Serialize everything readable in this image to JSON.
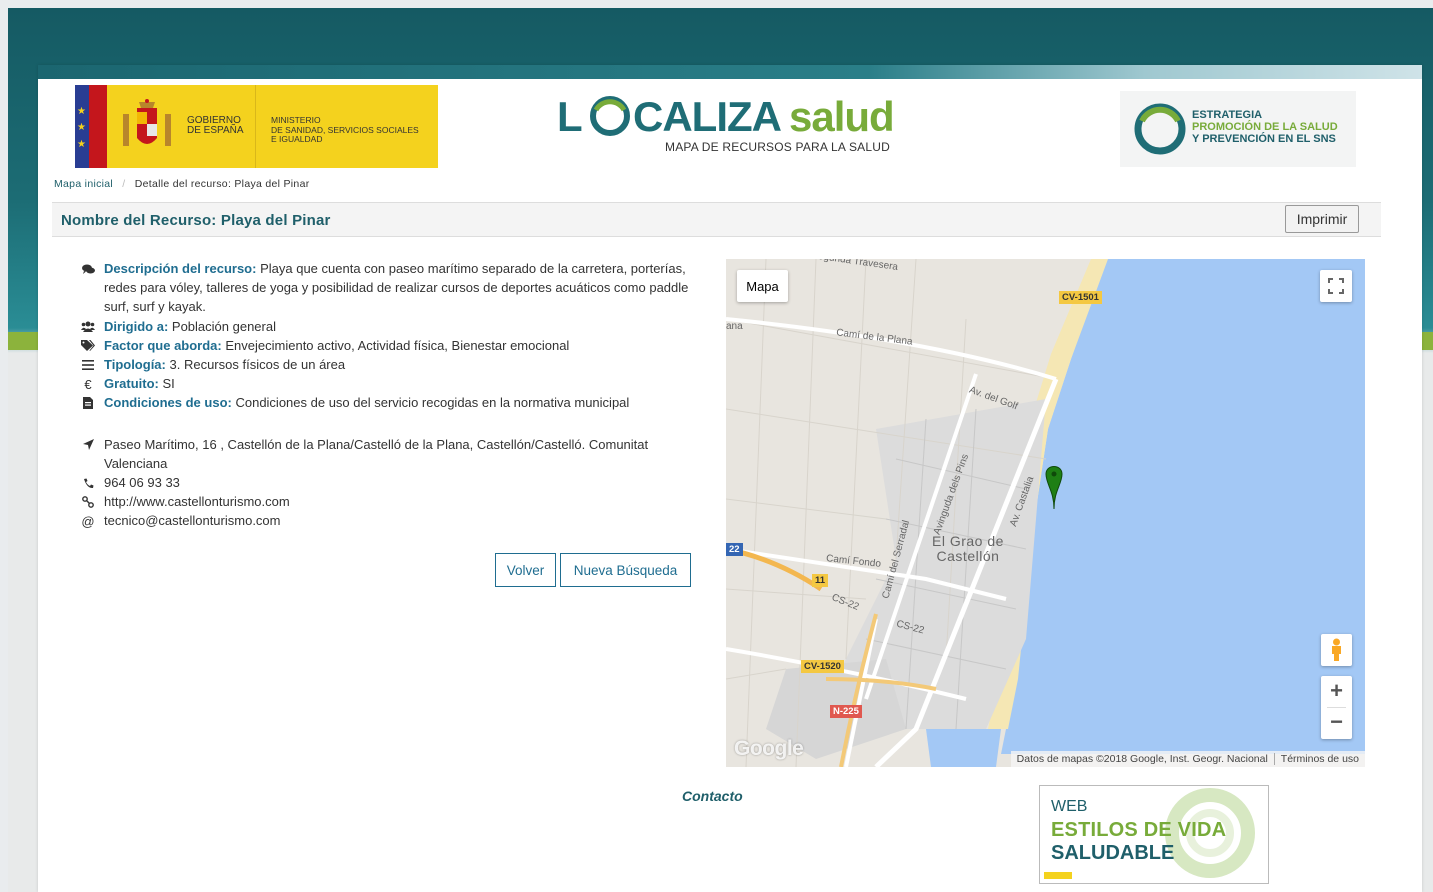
{
  "header": {
    "gov_line1": "GOBIERNO",
    "gov_line2": "DE ESPAÑA",
    "ministry_line1": "MINISTERIO",
    "ministry_line2": "DE SANIDAD, SERVICIOS SOCIALES",
    "ministry_line3": "E IGUALDAD",
    "brand_l": "L",
    "brand_caliza": "CALIZA",
    "brand_salud": "salud",
    "brand_subtitle": "MAPA DE RECURSOS PARA LA SALUD",
    "estrategia_line1": "ESTRATEGIA",
    "estrategia_line2": "PROMOCIÓN DE LA SALUD",
    "estrategia_line3": "Y PREVENCIÓN EN EL SNS"
  },
  "breadcrumb": {
    "home": "Mapa inicial",
    "separator": "/",
    "current": "Detalle del recurso: Playa del Pinar"
  },
  "resource": {
    "title": "Nombre del Recurso: Playa del Pinar",
    "print_label": "Imprimir",
    "description_label": "Descripción del recurso:",
    "description": "Playa que cuenta con paseo marítimo separado de la carretera, porterías, redes para vóley, talleres de yoga y posibilidad de realizar cursos de deportes acuáticos como paddle surf, surf y kayak.",
    "target_label": "Dirigido a:",
    "target": "Población general",
    "factor_label": "Factor que aborda:",
    "factor": "Envejecimiento activo, Actividad física, Bienestar emocional",
    "type_label": "Tipología:",
    "type": "3. Recursos físicos de un área",
    "free_label": "Gratuito:",
    "free": "SI",
    "conditions_label": "Condiciones de uso:",
    "conditions": "Condiciones de uso del servicio recogidas en la normativa municipal",
    "address": "Paseo Marítimo, 16 , Castellón de la Plana/Castelló de la Plana, Castellón/Castelló. Comunitat Valenciana",
    "phone": "964 06 93 33",
    "website": "http://www.castellonturismo.com",
    "email": "tecnico@castellonturismo.com",
    "back_label": "Volver",
    "new_search_label": "Nueva Búsqueda"
  },
  "map": {
    "type_label": "Mapa",
    "road_cv1501": "CV-1501",
    "road_cv1520": "CV-1520",
    "road_n225": "N-225",
    "road_22": "22",
    "road_11": "11",
    "street_travesera": "Segunda Travesera",
    "street_plana": "Camí de la Plana",
    "street_golf": "Av. del Golf",
    "street_pins": "Avinguda dels Pins",
    "street_castalia": "Av. Castalia",
    "street_serradal": "Camí del Serradal",
    "street_fondo": "Camí Fondo",
    "street_cs22a": "CS-22",
    "street_cs22b": "CS-22",
    "street_ana": "ana",
    "town_line1": "El Grao de",
    "town_line2": "Castellón",
    "logo": "Google",
    "attribution": "Datos de mapas ©2018 Google, Inst. Geogr. Nacional",
    "terms": "Términos de uso",
    "zoom_in": "+",
    "zoom_out": "−",
    "colors": {
      "sea": "#a3c8f5",
      "beach": "#f5e7b4",
      "land": "#e6e3dc",
      "marker": "#1e7f14"
    }
  },
  "footer": {
    "contact": "Contacto",
    "banner_web": "WEB",
    "banner_line1": "ESTILOS DE VIDA",
    "banner_line2": "SALUDABLE"
  },
  "icons": [
    "comments-icon",
    "users-icon",
    "tags-icon",
    "list-icon",
    "euro-icon",
    "document-icon",
    "location-arrow-icon",
    "phone-icon",
    "link-icon",
    "at-icon"
  ]
}
